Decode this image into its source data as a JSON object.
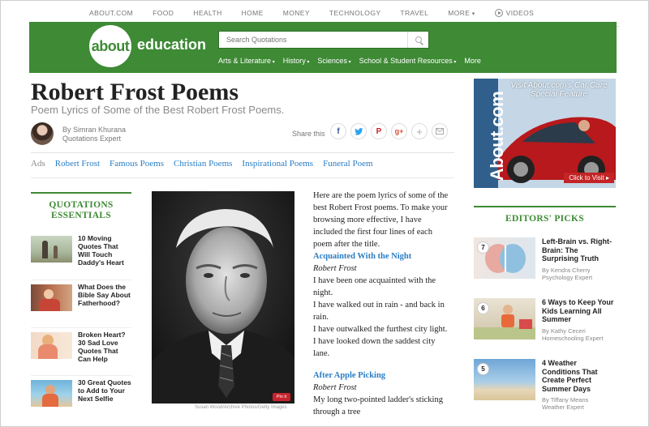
{
  "topnav": {
    "items": [
      "ABOUT.COM",
      "FOOD",
      "HEALTH",
      "HOME",
      "MONEY",
      "TECHNOLOGY",
      "TRAVEL",
      "MORE"
    ],
    "videos": "VIDEOS"
  },
  "header": {
    "logo_word": "about",
    "logo_section": "education",
    "search_placeholder": "Search Quotations",
    "categories": [
      "Arts & Literature",
      "History",
      "Sciences",
      "School & Student Resources",
      "More"
    ]
  },
  "article": {
    "title": "Robert Frost Poems",
    "subtitle": "Poem Lyrics of Some of the Best Robert Frost Poems.",
    "author_byline": "By Simran Khurana",
    "author_role": "Quotations Expert",
    "share_label": "Share this",
    "share_icons": [
      "facebook-icon",
      "twitter-icon",
      "pinterest-icon",
      "google-plus-icon",
      "plus-icon",
      "email-icon"
    ],
    "ads_label": "Ads",
    "ad_links": [
      "Robert Frost",
      "Famous Poems",
      "Christian Poems",
      "Inspirational Poems",
      "Funeral Poem"
    ],
    "photo_credit": "Susan Wood/Archive Photos/Getty Images",
    "pin_label": "Pin it",
    "intro": "Here are the poem lyrics of some of the best Robert Frost poems. To make your browsing more effective, I have included the first four lines of each poem after the title.",
    "poem1_title": "Acquainted With the Night",
    "poem1_author": "Robert Frost",
    "poem1_lines": [
      "I have been one acquainted with the night.",
      "I have walked out in rain - and back in rain.",
      "I have outwalked the furthest city light.",
      "I have looked down the saddest city lane."
    ],
    "poem2_title": "After Apple Picking",
    "poem2_author": "Robert Frost",
    "poem2_lines": [
      "My long two-pointed ladder's sticking through a tree"
    ]
  },
  "sidebar_left": {
    "title_line1": "QUOTATIONS",
    "title_line2": "ESSENTIALS",
    "items": [
      "10 Moving Quotes That Will Touch Daddy's Heart",
      "What Does the Bible Say About Fatherhood?",
      "Broken Heart? 30 Sad Love Quotes That Can Help",
      "30 Great Quotes to Add to Your Next Selfie"
    ]
  },
  "ad_banner": {
    "headline": "Visit About.com's Car Care Special Feature",
    "brand": "About.com",
    "cta": "Click to Visit ▸"
  },
  "editors_picks": {
    "title": "EDITORS' PICKS",
    "items": [
      {
        "num": "7",
        "title": "Left-Brain vs. Right-Brain: The Surprising Truth",
        "by": "By Kendra Cherry",
        "role": "Psychology Expert"
      },
      {
        "num": "6",
        "title": "6 Ways to Keep Your Kids Learning All Summer",
        "by": "By Kathy Ceceri",
        "role": "Homeschooling Expert"
      },
      {
        "num": "5",
        "title": "4 Weather Conditions That Create Perfect Summer Days",
        "by": "By Tiffany Means",
        "role": "Weather Expert"
      }
    ]
  },
  "colors": {
    "brand_green": "#3e8a35",
    "link_blue": "#2a7dc4",
    "ad_red": "#c32425"
  }
}
